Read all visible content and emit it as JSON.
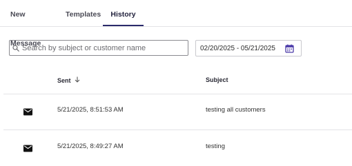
{
  "tabs": [
    {
      "label": "New Message",
      "active": false
    },
    {
      "label": "Templates",
      "active": false
    },
    {
      "label": "History",
      "active": true
    }
  ],
  "search": {
    "placeholder": "Search by subject or customer name",
    "value": "",
    "icon": "search-icon"
  },
  "date_range": {
    "value": "02/20/2025 - 05/21/2025",
    "icon": "calendar-icon"
  },
  "table": {
    "columns": [
      {
        "label": "Sent",
        "sort": "descending"
      },
      {
        "label": "Subject"
      }
    ],
    "rows": [
      {
        "icon": "mail-icon",
        "sent": "5/21/2025, 8:51:53 AM",
        "subject": "testing all customers"
      },
      {
        "icon": "mail-icon",
        "sent": "5/21/2025, 8:49:27 AM",
        "subject": "testing"
      }
    ]
  },
  "colors": {
    "active_tab_underline": "#2a2a6b",
    "calendar_icon": "#4b3aa8",
    "divider": "#e3e3e6"
  }
}
